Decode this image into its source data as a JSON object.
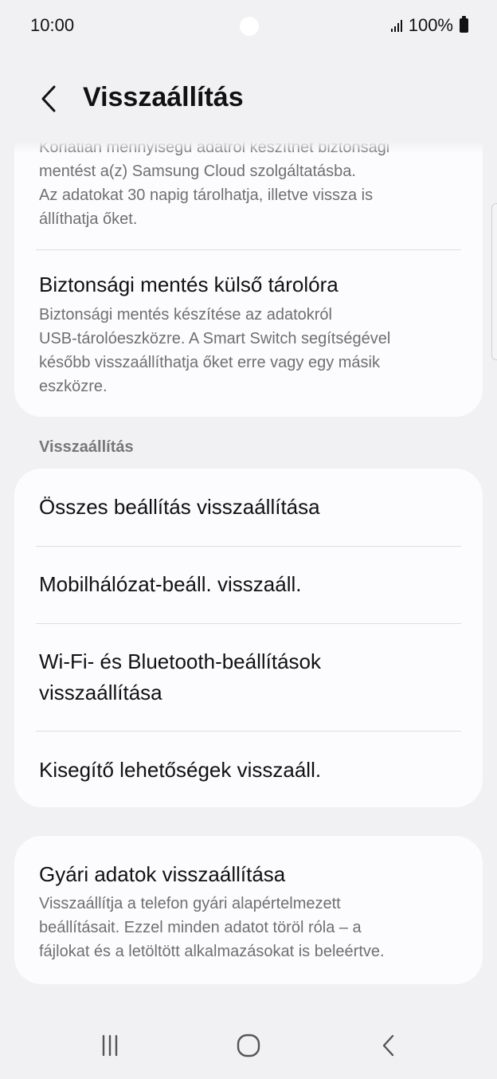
{
  "status_bar": {
    "time": "10:00",
    "battery": "100%"
  },
  "header": {
    "title": "Visszaállítás"
  },
  "backup_card": {
    "cloud_desc_lines": [
      "Korlátlan mennyiségű adatról készíthet biztonsági",
      "mentést a(z) Samsung Cloud szolgáltatásba.",
      "Az adatokat 30 napig tárolhatja, illetve vissza is",
      "állíthatja őket."
    ],
    "external_title": "Biztonsági mentés külső tárolóra",
    "external_desc_lines": [
      "Biztonsági mentés készítése az adatokról",
      "USB-tárolóeszközre. A Smart Switch segítségével",
      "később visszaállíthatja őket erre vagy egy másik",
      "eszközre."
    ]
  },
  "reset_section": {
    "label": "Visszaállítás",
    "items": [
      {
        "label": "Összes beállítás visszaállítása"
      },
      {
        "label": "Mobilhálózat-beáll. visszaáll."
      },
      {
        "label_line1": "Wi-Fi- és Bluetooth-beállítások",
        "label_line2": "visszaállítása"
      },
      {
        "label": "Kisegítő lehetőségek visszaáll."
      }
    ]
  },
  "factory_reset": {
    "title": "Gyári adatok visszaállítása",
    "desc_lines": [
      "Visszaállítja a telefon gyári alapértelmezett",
      "beállításait. Ezzel minden adatot töröl róla – a",
      "fájlokat és a letöltött alkalmazásokat is beleértve."
    ]
  },
  "nav": {
    "icons": [
      "recents-icon",
      "home-icon",
      "back-icon"
    ]
  }
}
